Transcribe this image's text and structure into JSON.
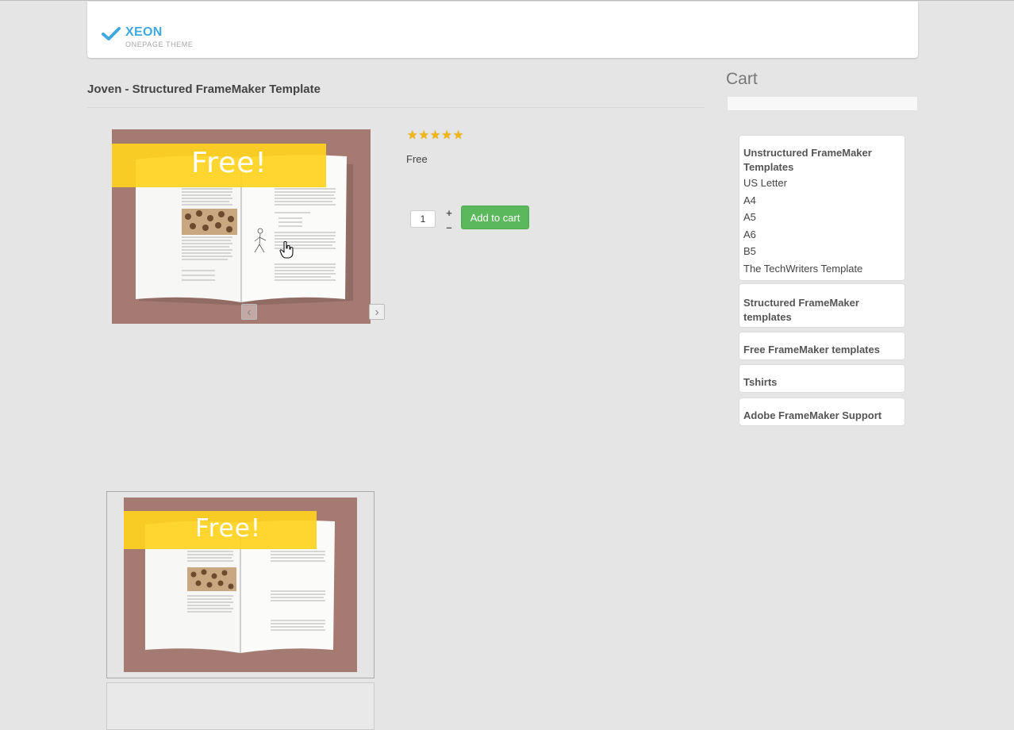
{
  "brand": {
    "name": "XEON",
    "tagline": "ONEPAGE THEME",
    "accent": "#3fa9e0"
  },
  "product": {
    "title": "Joven - Structured FrameMaker Template",
    "rating": 5,
    "rating_max": 5,
    "price": "Free",
    "image_banner": "Free!",
    "quantity": "1",
    "plus": "+",
    "minus": "–",
    "add_to_cart": "Add to cart"
  },
  "slider": {
    "prev": "‹",
    "next": "›"
  },
  "cart": {
    "heading": "Cart"
  },
  "categories": [
    {
      "title": "Unstructured FrameMaker Templates",
      "items": [
        "US Letter",
        "A4",
        "A5",
        "A6",
        "B5",
        "The TechWriters Template"
      ]
    },
    {
      "title": "Structured FrameMaker templates"
    },
    {
      "title": "Free FrameMaker templates"
    },
    {
      "title": "Tshirts"
    },
    {
      "title": "Adobe FrameMaker Support"
    }
  ],
  "colors": {
    "button_green": "#5cb85c",
    "banner_yellow": "#ffd21e",
    "image_bg": "#a47a72",
    "star": "#f2b70f"
  }
}
